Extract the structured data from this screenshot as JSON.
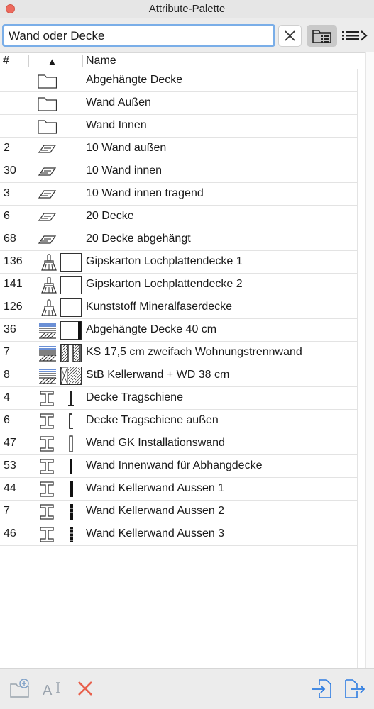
{
  "window": {
    "title": "Attribute-Palette"
  },
  "search": {
    "value": "Wand oder Decke"
  },
  "columns": {
    "number": "#",
    "sort_indicator": "▲",
    "name": "Name"
  },
  "rows": [
    {
      "num": "",
      "type": "folder-icon",
      "preview": "",
      "name": "Abgehängte Decke"
    },
    {
      "num": "",
      "type": "folder-icon",
      "preview": "",
      "name": "Wand Außen"
    },
    {
      "num": "",
      "type": "folder-icon",
      "preview": "",
      "name": "Wand Innen"
    },
    {
      "num": "2",
      "type": "layer-icon",
      "preview": "",
      "name": "10 Wand außen"
    },
    {
      "num": "30",
      "type": "layer-icon",
      "preview": "",
      "name": "10 Wand innen"
    },
    {
      "num": "3",
      "type": "layer-icon",
      "preview": "",
      "name": "10 Wand innen tragend"
    },
    {
      "num": "6",
      "type": "layer-icon",
      "preview": "",
      "name": "20 Decke"
    },
    {
      "num": "68",
      "type": "layer-icon",
      "preview": "",
      "name": "20 Decke abgehängt"
    },
    {
      "num": "136",
      "type": "surface-brush-icon",
      "preview": "blank",
      "name": "Gipskarton Lochplattendecke 1"
    },
    {
      "num": "141",
      "type": "surface-brush-icon",
      "preview": "blank",
      "name": "Gipskarton Lochplattendecke 2"
    },
    {
      "num": "126",
      "type": "surface-brush-icon",
      "preview": "blank",
      "name": "Kunststoff Mineralfaserdecke"
    },
    {
      "num": "36",
      "type": "composite-icon",
      "preview": "composite-1",
      "name": "Abgehängte Decke 40 cm"
    },
    {
      "num": "7",
      "type": "composite-icon",
      "preview": "composite-2",
      "name": "KS 17,5 cm zweifach Wohnungstrennwand"
    },
    {
      "num": "8",
      "type": "composite-icon",
      "preview": "composite-3",
      "name": "StB Kellerwand + WD 38 cm"
    },
    {
      "num": "4",
      "type": "profile-icon",
      "preview": "profile-t",
      "name": "Decke Tragschiene"
    },
    {
      "num": "6",
      "type": "profile-icon",
      "preview": "profile-l",
      "name": "Decke Tragschiene außen"
    },
    {
      "num": "47",
      "type": "profile-icon",
      "preview": "profile-thin",
      "name": "Wand GK Installationswand"
    },
    {
      "num": "53",
      "type": "profile-icon",
      "preview": "profile-bar",
      "name": "Wand Innenwand für Abhangdecke"
    },
    {
      "num": "44",
      "type": "profile-icon",
      "preview": "profile-thick",
      "name": "Wand Kellerwand Aussen 1"
    },
    {
      "num": "7",
      "type": "profile-icon",
      "preview": "profile-dash",
      "name": "Wand Kellerwand Aussen 2"
    },
    {
      "num": "46",
      "type": "profile-icon",
      "preview": "profile-dash2",
      "name": "Wand Kellerwand Aussen 3"
    }
  ],
  "toolbar": {
    "new_folder": "new-folder-icon",
    "rename": "rename-icon",
    "delete": "delete-icon",
    "import": "import-icon",
    "export": "export-icon",
    "delete_color": "#e8604c",
    "accent_color": "#2f7de1"
  }
}
